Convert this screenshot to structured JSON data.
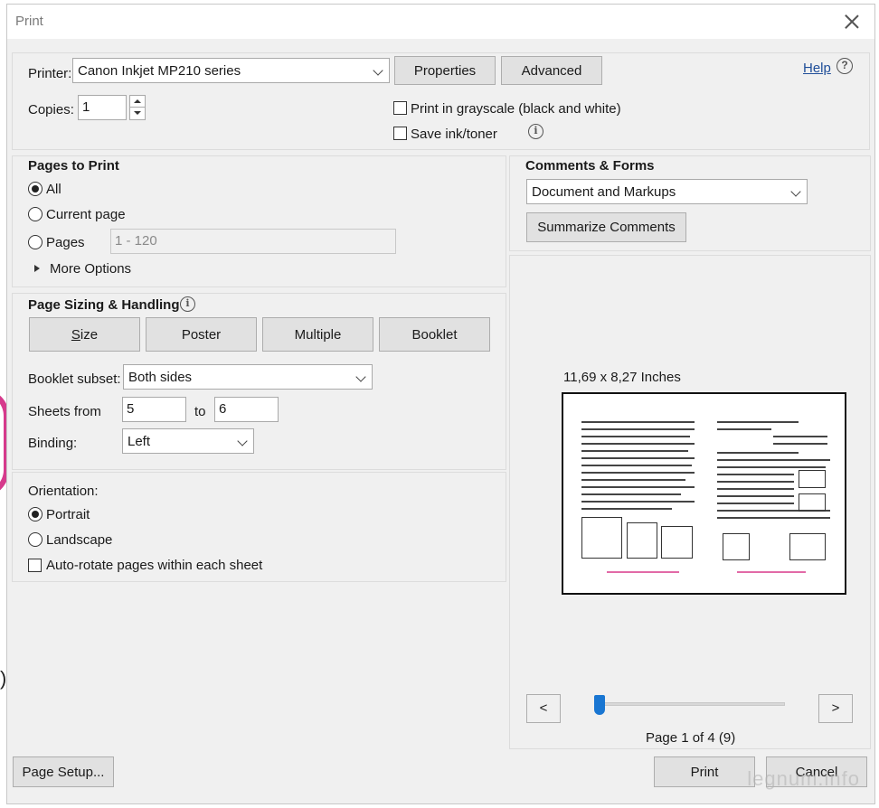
{
  "window": {
    "title": "Print"
  },
  "printer": {
    "label": "Printer:",
    "selected": "Canon Inkjet MP210 series",
    "properties_label": "Properties",
    "advanced_label": "Advanced",
    "help_label": "Help"
  },
  "copies": {
    "label": "Copies:",
    "value": "1"
  },
  "options": {
    "grayscale_label": "Print in grayscale (black and white)",
    "grayscale_checked": false,
    "save_ink_label": "Save ink/toner",
    "save_ink_checked": false
  },
  "pages_to_print": {
    "heading": "Pages to Print",
    "all_label": "All",
    "current_label": "Current page",
    "pages_label": "Pages",
    "pages_placeholder": "1 - 120",
    "more_options_label": "More Options",
    "selected": "All"
  },
  "sizing": {
    "heading": "Page Sizing & Handling",
    "tabs": [
      {
        "label": "Size"
      },
      {
        "label": "Poster"
      },
      {
        "label": "Multiple"
      },
      {
        "label": "Booklet"
      }
    ],
    "booklet_subset_label": "Booklet subset:",
    "booklet_subset_value": "Both sides",
    "sheets_from_label": "Sheets from",
    "sheets_from_value": "5",
    "to_label": "to",
    "sheets_to_value": "6",
    "binding_label": "Binding:",
    "binding_value": "Left"
  },
  "orientation": {
    "heading": "Orientation:",
    "portrait_label": "Portrait",
    "landscape_label": "Landscape",
    "autorotate_label": "Auto-rotate pages within each sheet",
    "selected": "Portrait",
    "autorotate_checked": false
  },
  "comments": {
    "heading": "Comments & Forms",
    "selected": "Document and Markups",
    "summarize_label": "Summarize Comments"
  },
  "preview": {
    "size_text": "11,69 x 8,27 Inches",
    "prev_label": "<",
    "next_label": ">",
    "page_indicator": "Page 1 of 4 (9)",
    "slider_position": 0
  },
  "footer": {
    "page_setup_label": "Page Setup...",
    "print_label": "Print",
    "cancel_label": "Cancel"
  },
  "watermark": "legnum.info",
  "colors": {
    "dialog_bg": "#f0f0f0",
    "button_bg": "#e1e1e1",
    "link": "#1f4e99",
    "slider_thumb": "#1976d2",
    "preview_pink": "#e26aa7"
  }
}
